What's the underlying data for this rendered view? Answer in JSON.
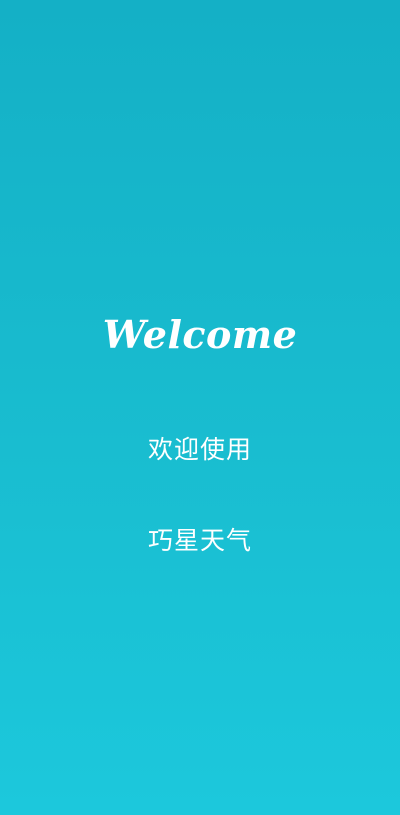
{
  "splash": {
    "welcome_text": "Welcome",
    "subtitle": "欢迎使用",
    "app_name": "巧星天气"
  },
  "colors": {
    "background_top": "#14b0c6",
    "background_bottom": "#1cc8dc",
    "text": "#ffffff"
  }
}
